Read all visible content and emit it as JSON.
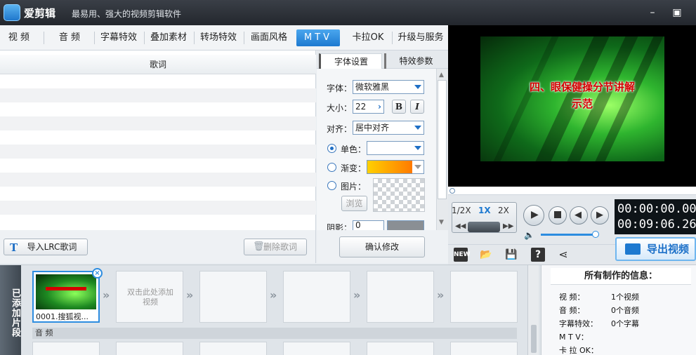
{
  "app": {
    "name": "爱剪辑",
    "slogan": "最易用、强大的视频剪辑软件"
  },
  "tabs": [
    {
      "label": "视 频"
    },
    {
      "label": "音 频"
    },
    {
      "label": "字幕特效"
    },
    {
      "label": "叠加素材"
    },
    {
      "label": "转场特效"
    },
    {
      "label": "画面风格"
    },
    {
      "label": "MTV"
    },
    {
      "label": "卡拉OK"
    },
    {
      "label": "升级与服务"
    }
  ],
  "lyrics": {
    "header": "歌词",
    "import_button": "导入LRC歌词",
    "delete_button": "删除歌词"
  },
  "settings": {
    "tab_font": "字体设置",
    "tab_effect": "特效参数",
    "font_label": "字体：",
    "font_value": "微软雅黑",
    "size_label": "大小：",
    "size_value": "22",
    "bold": "B",
    "italic": "I",
    "align_label": "对齐：",
    "align_value": "居中对齐",
    "solid_label": "单色：",
    "gradient_label": "渐变：",
    "image_label": "图片：",
    "browse_button": "浏览",
    "shadow_label": "阴影：",
    "shadow_value": "0",
    "confirm_button": "确认修改"
  },
  "preview": {
    "caption_line1": "四、眼保健操分节讲解",
    "caption_line2": "示范"
  },
  "playback": {
    "speed_half": "1/2X",
    "speed_1x": "1X",
    "speed_2x": "2X",
    "current_time": "00:00:00.00",
    "total_time": "00:09:06.26",
    "export_label": "导出视频"
  },
  "clips": {
    "added_tab": "已添加片段",
    "clip1_name": "0001.搜狐视...",
    "add_hint": "双击此处添加视频",
    "audio_label": "音 频"
  },
  "info": {
    "title": "所有制作的信息：",
    "rows": [
      {
        "key": "视    频：",
        "value": "1个视频"
      },
      {
        "key": "音    频：",
        "value": "0个音频"
      },
      {
        "key": "字幕特效：",
        "value": "0个字幕"
      },
      {
        "key": "M   T   V：",
        "value": ""
      },
      {
        "key": "卡 拉 OK：",
        "value": ""
      }
    ]
  },
  "colors": {
    "accent": "#1d79d0",
    "titlebar": "#2b3037",
    "gradient_start": "#ffd000",
    "gradient_end": "#ff7a00"
  }
}
